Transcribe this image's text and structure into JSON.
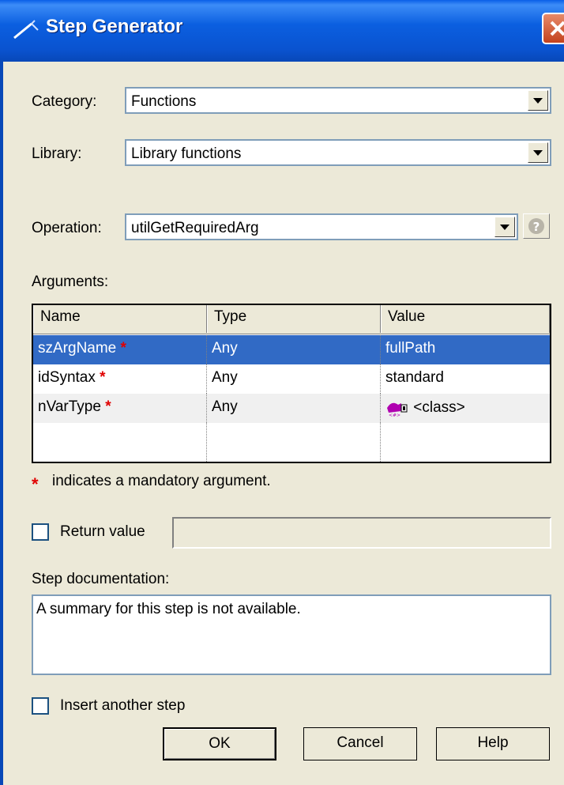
{
  "window": {
    "title": "Step Generator",
    "icon": "wand-icon",
    "close_icon": "close-icon"
  },
  "category": {
    "label": "Category:",
    "value": "Functions"
  },
  "library": {
    "label": "Library:",
    "value": "Library functions"
  },
  "operation": {
    "label": "Operation:",
    "value": "utilGetRequiredArg",
    "help_icon": "question-icon"
  },
  "arguments": {
    "label": "Arguments:",
    "columns": [
      "Name",
      "Type",
      "Value"
    ],
    "rows": [
      {
        "name": "szArgName",
        "mandatory": "*",
        "type": "Any",
        "value": "fullPath",
        "selected": true
      },
      {
        "name": "idSyntax",
        "mandatory": "*",
        "type": "Any",
        "value": "standard"
      },
      {
        "name": "nVarType",
        "mandatory": "*",
        "type": "Any",
        "value": "<class>",
        "value_icon": "class-icon"
      }
    ],
    "note_star": "*",
    "note": "indicates a mandatory argument."
  },
  "return_value": {
    "label": "Return value",
    "checked": false,
    "value": ""
  },
  "step_doc": {
    "label": "Step documentation:",
    "value": "A summary for this step is not available."
  },
  "insert_another": {
    "label": "Insert another step",
    "checked": false
  },
  "buttons": {
    "ok": "OK",
    "cancel": "Cancel",
    "help": "Help"
  },
  "colors": {
    "title_bar": "#0a53d0",
    "selection": "#316ac5",
    "mandatory": "#e00000",
    "dialog_bg": "#ece9d8"
  }
}
